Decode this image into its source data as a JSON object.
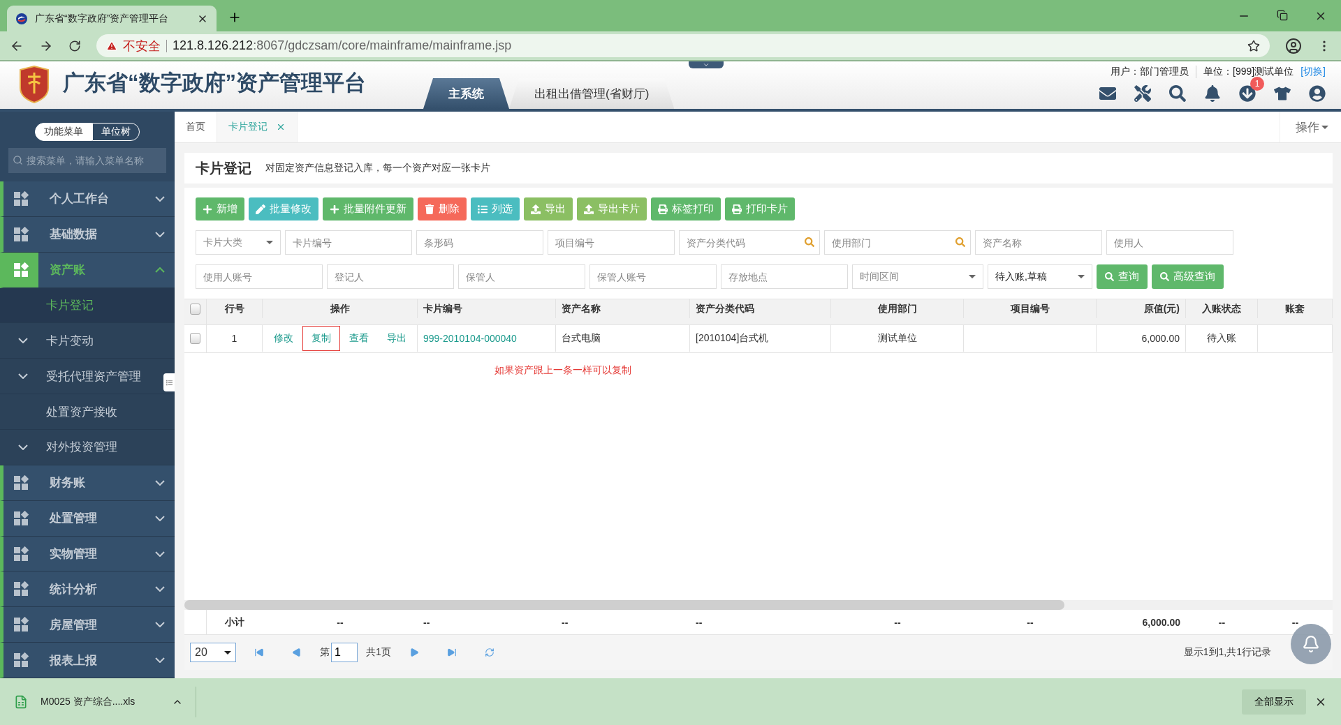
{
  "browser": {
    "tab_title": "广东省“数字政府”资产管理平台",
    "security": "不安全",
    "url_host": "121.8.126.212",
    "url_path": ":8067/gdczsam/core/mainframe/mainframe.jsp"
  },
  "header": {
    "title": "广东省“数字政府”资产管理平台",
    "systems": [
      {
        "label": "主系统",
        "selected": true
      },
      {
        "label": "出租出借管理(省财厅)",
        "selected": false
      }
    ],
    "user": "用户：部门管理员",
    "unit": "单位：[999]测试单位",
    "switch": "[切换]",
    "badge": "1"
  },
  "sidebar": {
    "modes": [
      {
        "label": "功能菜单",
        "selected": true
      },
      {
        "label": "单位树",
        "selected": false
      }
    ],
    "search_placeholder": "搜索菜单，请输入菜单名称",
    "menu": [
      {
        "label": "个人工作台",
        "expanded": false,
        "selected": false
      },
      {
        "label": "基础数据",
        "expanded": false,
        "selected": false
      },
      {
        "label": "资产账",
        "expanded": true,
        "selected": true,
        "children": [
          {
            "label": "卡片登记",
            "selected": true,
            "expandable": false
          },
          {
            "label": "卡片变动",
            "selected": false,
            "expandable": true
          },
          {
            "label": "受托代理资产管理",
            "selected": false,
            "expandable": true
          },
          {
            "label": "处置资产接收",
            "selected": false,
            "expandable": false
          },
          {
            "label": "对外投资管理",
            "selected": false,
            "expandable": true
          }
        ]
      },
      {
        "label": "财务账",
        "expanded": false,
        "selected": false
      },
      {
        "label": "处置管理",
        "expanded": false,
        "selected": false
      },
      {
        "label": "实物管理",
        "expanded": false,
        "selected": false
      },
      {
        "label": "统计分析",
        "expanded": false,
        "selected": false
      },
      {
        "label": "房屋管理",
        "expanded": false,
        "selected": false
      },
      {
        "label": "报表上报",
        "expanded": false,
        "selected": false
      }
    ]
  },
  "tabs": [
    {
      "label": "首页",
      "selected": false,
      "closable": false
    },
    {
      "label": "卡片登记",
      "selected": true,
      "closable": true
    }
  ],
  "operations_menu": "操作",
  "page": {
    "title": "卡片登记",
    "description": "对固定资产信息登记入库，每一个资产对应一张卡片"
  },
  "toolbar": [
    {
      "label": "新增",
      "kind": "add",
      "color": "#5fb86b"
    },
    {
      "label": "批量修改",
      "kind": "edit",
      "color": "#4bbdc0"
    },
    {
      "label": "批量附件更新",
      "kind": "add",
      "color": "#5fb86b"
    },
    {
      "label": "删除",
      "kind": "delete",
      "color": "#f5695a"
    },
    {
      "label": "列选",
      "kind": "list",
      "color": "#4bbdc0"
    },
    {
      "label": "导出",
      "kind": "upload",
      "color": "#8bbf63"
    },
    {
      "label": "导出卡片",
      "kind": "upload",
      "color": "#8bbf63"
    },
    {
      "label": "标签打印",
      "kind": "print",
      "color": "#5fb86b"
    },
    {
      "label": "打印卡片",
      "kind": "print",
      "color": "#5fb86b"
    }
  ],
  "filters": [
    [
      {
        "kind": "select",
        "placeholder": "卡片大类"
      },
      {
        "kind": "text",
        "placeholder": "卡片编号"
      },
      {
        "kind": "text",
        "placeholder": "条形码"
      },
      {
        "kind": "text",
        "placeholder": "项目编号"
      },
      {
        "kind": "search",
        "placeholder": "资产分类代码"
      },
      {
        "kind": "search",
        "placeholder": "使用部门"
      },
      {
        "kind": "text",
        "placeholder": "资产名称"
      },
      {
        "kind": "text",
        "placeholder": "使用人"
      }
    ],
    [
      {
        "kind": "text",
        "placeholder": "使用人账号"
      },
      {
        "kind": "text",
        "placeholder": "登记人"
      },
      {
        "kind": "text",
        "placeholder": "保管人"
      },
      {
        "kind": "text",
        "placeholder": "保管人账号"
      },
      {
        "kind": "text",
        "placeholder": "存放地点"
      },
      {
        "kind": "select",
        "placeholder": "时间区间"
      },
      {
        "kind": "select",
        "value": "待入账,草稿"
      }
    ]
  ],
  "search_buttons": [
    "查询",
    "高级查询"
  ],
  "table": {
    "all_selected": false,
    "columns": [
      "行号",
      "操作",
      "卡片编号",
      "资产名称",
      "资产分类代码",
      "使用部门",
      "项目编号",
      "原值(元)",
      "入账状态",
      "账套"
    ],
    "rows": [
      {
        "selected": false,
        "cells": [
          "1",
          null,
          "999-2010104-000040",
          "台式电脑",
          "[2010104]台式机",
          "测试单位",
          "",
          "6,000.00",
          "待入账",
          ""
        ],
        "actions": [
          {
            "label": "修改",
            "highlighted": false
          },
          {
            "label": "复制",
            "highlighted": true
          },
          {
            "label": "查看",
            "highlighted": false
          },
          {
            "label": "导出",
            "highlighted": false
          }
        ]
      }
    ],
    "annotation": "如果资产跟上一条一样可以复制",
    "summary": [
      "小计",
      "--",
      "--",
      "--",
      "--",
      "--",
      "--",
      "6,000.00",
      "--",
      "--"
    ]
  },
  "pager": {
    "page_size": "20",
    "page_prefix": "第",
    "page": "1",
    "total": "共1页",
    "info": "显示1到1,共1行记录"
  },
  "downloads": {
    "file": "M0025 资产综合....xls",
    "show_all": "全部显示"
  }
}
